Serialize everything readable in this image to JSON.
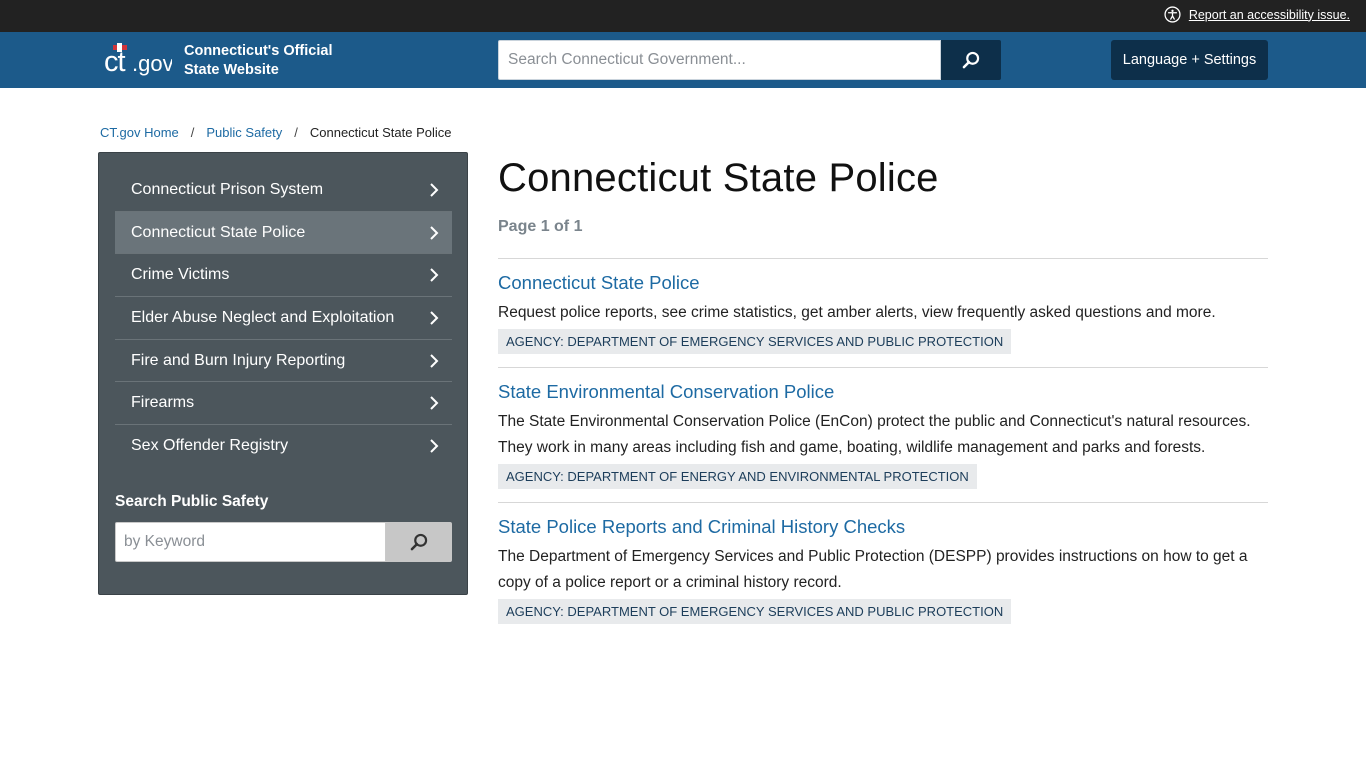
{
  "utility": {
    "accessibility_link": "Report an accessibility issue."
  },
  "header": {
    "logo_text": "ct.gov",
    "site_name_line1": "Connecticut's Official",
    "site_name_line2": "State Website",
    "search_placeholder": "Search Connecticut Government...",
    "language_button": "Language + Settings"
  },
  "breadcrumb": {
    "home": "CT.gov Home",
    "parent": "Public Safety",
    "current": "Connecticut State Police",
    "separator": "/"
  },
  "sidebar": {
    "items": [
      {
        "label": "Connecticut Prison System"
      },
      {
        "label": "Connecticut State Police"
      },
      {
        "label": "Crime Victims"
      },
      {
        "label": "Elder Abuse Neglect and Exploitation"
      },
      {
        "label": "Fire and Burn Injury Reporting"
      },
      {
        "label": "Firearms"
      },
      {
        "label": "Sex Offender Registry"
      }
    ],
    "active_index": 1,
    "search_title": "Search Public Safety",
    "search_placeholder": "by Keyword"
  },
  "main": {
    "title": "Connecticut State Police",
    "pager": "Page 1 of 1",
    "results": [
      {
        "title": "Connecticut State Police",
        "description": "Request police reports, see crime statistics, get amber alerts, view frequently asked questions and more.",
        "badge": "AGENCY: DEPARTMENT OF EMERGENCY SERVICES AND PUBLIC PROTECTION"
      },
      {
        "title": "State Environmental Conservation Police",
        "description": "The State Environmental Conservation Police (EnCon) protect the public and Connecticut's natural resources.  They work in many areas including fish and game, boating, wildlife management and parks and forests.",
        "badge": "AGENCY: DEPARTMENT OF ENERGY AND ENVIRONMENTAL PROTECTION"
      },
      {
        "title": "State Police Reports and Criminal History Checks",
        "description": "The Department of Emergency Services and Public Protection (DESPP) provides instructions on how to get a copy of a police report or a criminal history record.",
        "badge": "AGENCY: DEPARTMENT OF EMERGENCY SERVICES AND PUBLIC PROTECTION"
      }
    ]
  },
  "colors": {
    "utility_bar": "#222222",
    "header": "#1c5a8a",
    "dark_button": "#0d2f4a",
    "sidebar": "#4c565c",
    "sidebar_active": "#6a747a",
    "link": "#1d6aa3"
  },
  "icons": {
    "accessibility": "accessibility-icon",
    "search": "search-icon",
    "chevron": "chevron-right-icon"
  }
}
